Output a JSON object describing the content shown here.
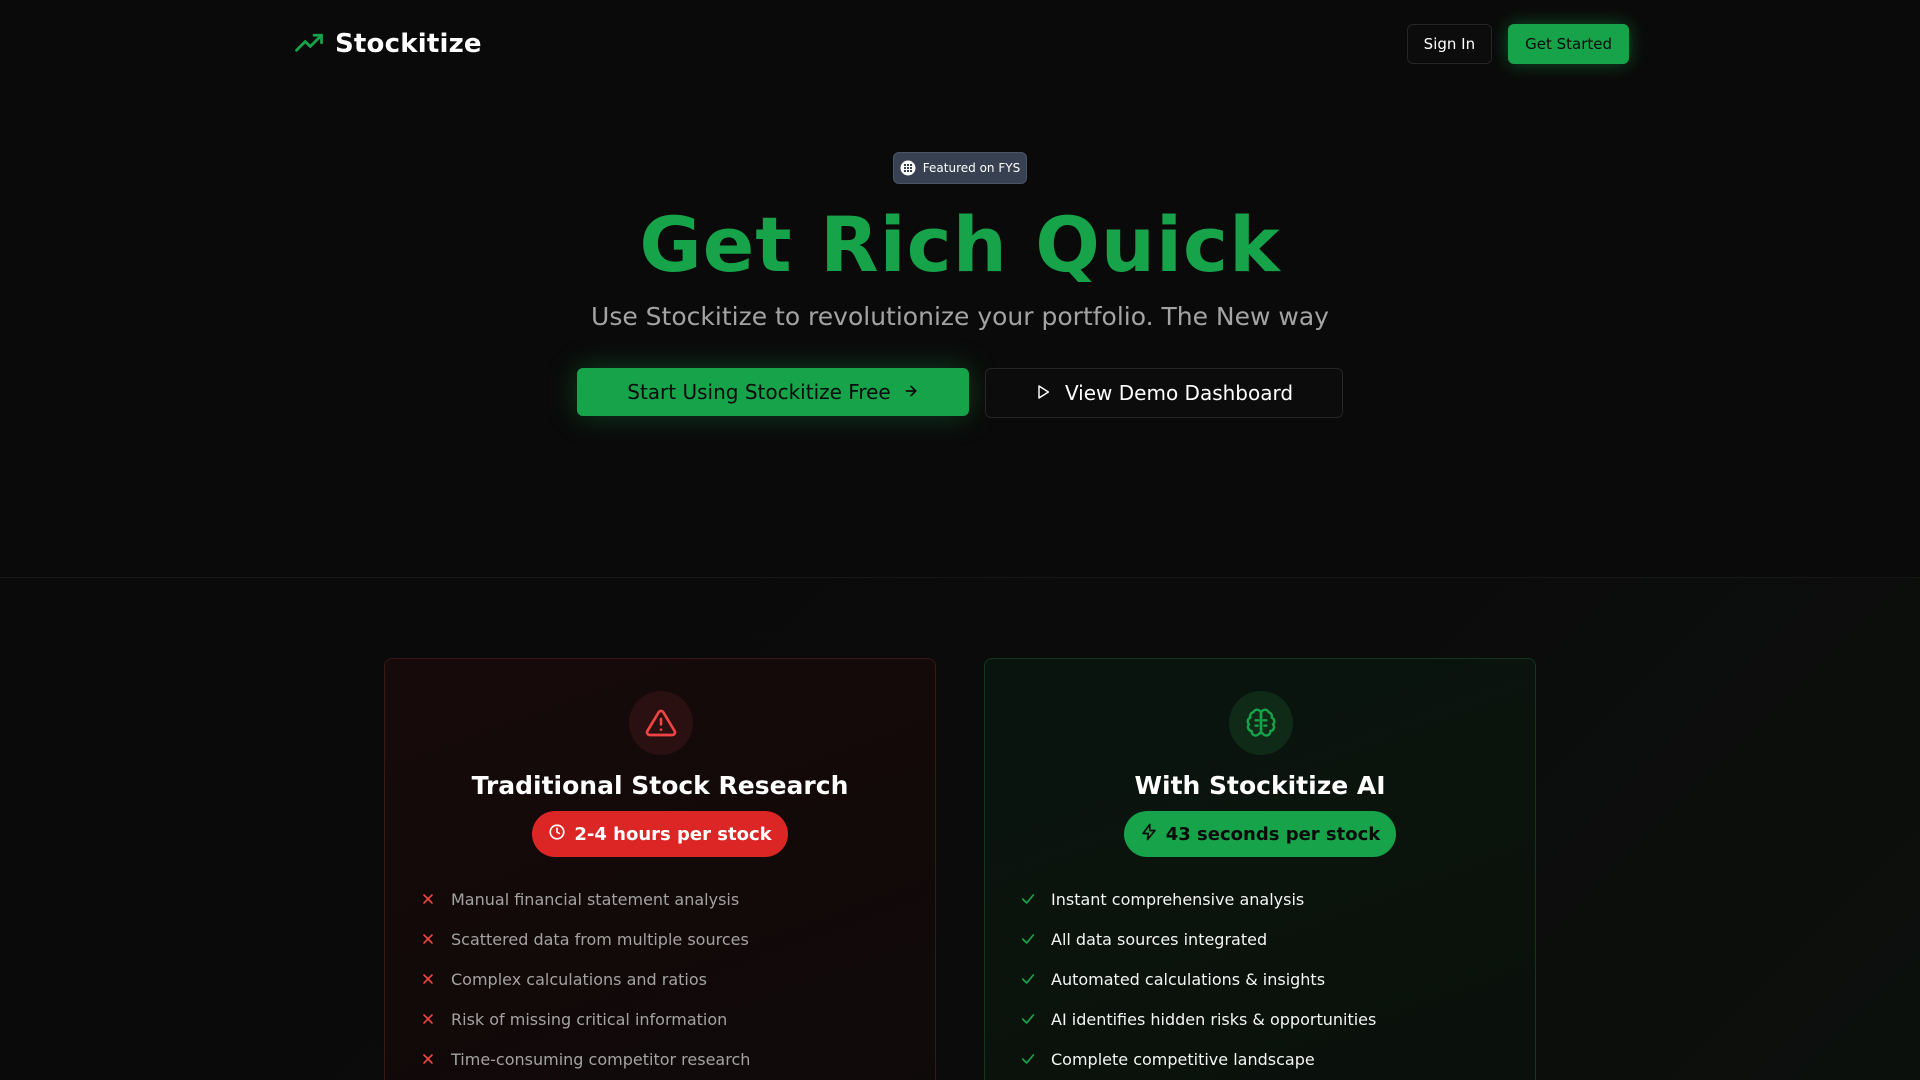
{
  "header": {
    "brand_name": "Stockitize",
    "sign_in_label": "Sign In",
    "get_started_label": "Get Started"
  },
  "hero": {
    "badge_label": "Featured on FYS",
    "title": "Get Rich Quick",
    "subtitle": "Use Stockitize to revolutionize your portfolio. The New way",
    "primary_cta": "Start Using Stockitize Free",
    "secondary_cta": "View Demo Dashboard"
  },
  "comparison": {
    "traditional": {
      "title": "Traditional Stock Research",
      "time_badge": "2-4 hours per stock",
      "icon": "warning-triangle-icon",
      "items": [
        "Manual financial statement analysis",
        "Scattered data from multiple sources",
        "Complex calculations and ratios",
        "Risk of missing critical information",
        "Time-consuming competitor research"
      ]
    },
    "stockitize": {
      "title": "With Stockitize AI",
      "time_badge": "43 seconds per stock",
      "icon": "brain-icon",
      "items": [
        "Instant comprehensive analysis",
        "All data sources integrated",
        "Automated calculations & insights",
        "AI identifies hidden risks & opportunities",
        "Complete competitive landscape"
      ]
    }
  },
  "colors": {
    "accent_green": "#16a34a",
    "danger_red": "#dc2626",
    "background": "#0a0a0a"
  }
}
